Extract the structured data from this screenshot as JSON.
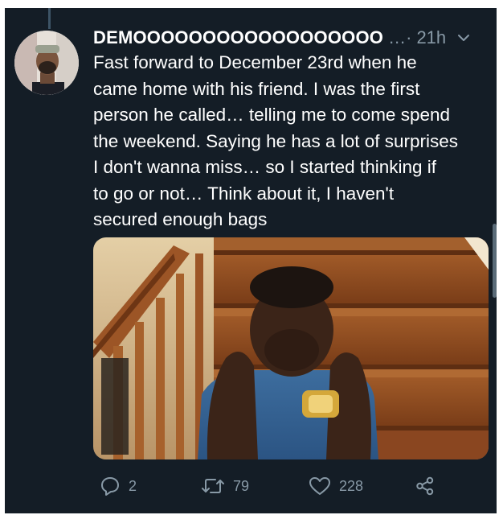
{
  "tweet": {
    "author_name": "DEMOOOOOOOOOOOOOOOOOO",
    "ellipsis": "…·",
    "time": "21h",
    "text_lines": [
      "Fast forward to December 23rd when he",
      "came home with his friend. I was the first",
      "person he called… telling me to come spend",
      "the weekend. Saying he has a lot of surprises",
      "I don't wanna miss… so I started thinking if",
      "to go or not… Think about it, I haven't",
      "secured enough bags"
    ]
  },
  "actions": {
    "reply": {
      "icon": "reply-icon",
      "count": "2"
    },
    "retweet": {
      "icon": "retweet-icon",
      "count": "79"
    },
    "like": {
      "icon": "heart-icon",
      "count": "228"
    },
    "share": {
      "icon": "share-icon"
    }
  },
  "colors": {
    "background": "#141d26",
    "text": "#ffffff",
    "muted": "#8899a6"
  }
}
